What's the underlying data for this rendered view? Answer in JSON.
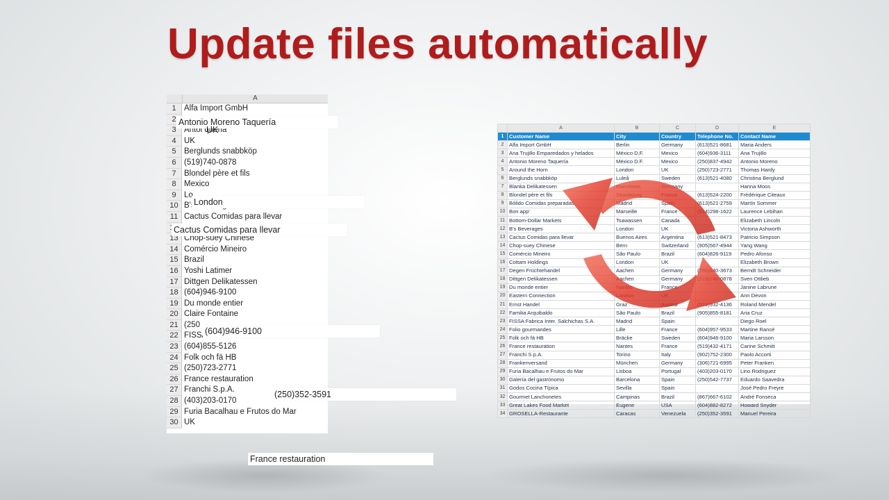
{
  "slide_title": "Update files automatically",
  "left_sheet": {
    "column_letter": "A",
    "rows": [
      {
        "n": "1",
        "v": "Alfa Import GmbH"
      },
      {
        "n": "2",
        "v": ""
      },
      {
        "n": "3",
        "v": "Antoi         queria"
      },
      {
        "n": "4",
        "v": "UK"
      },
      {
        "n": "5",
        "v": "Berglunds snabbköp"
      },
      {
        "n": "6",
        "v": "(519)740-0878"
      },
      {
        "n": "7",
        "v": "Blondel père et fils"
      },
      {
        "n": "8",
        "v": "Mexico"
      },
      {
        "n": "9",
        "v": "Lo"
      },
      {
        "n": "10",
        "v": "B's Beverages"
      },
      {
        "n": "11",
        "v": "Cactus Comidas para llevar"
      },
      {
        "n": "12",
        "v": ""
      },
      {
        "n": "13",
        "v": "Chop-suey Chinese"
      },
      {
        "n": "14",
        "v": "Comércio Mineiro"
      },
      {
        "n": "15",
        "v": "Brazil"
      },
      {
        "n": "16",
        "v": "Yoshi Latimer"
      },
      {
        "n": "17",
        "v": "Dittgen Delikatessen"
      },
      {
        "n": "18",
        "v": "(604)946-9100"
      },
      {
        "n": "19",
        "v": "Du monde entier"
      },
      {
        "n": "20",
        "v": "Claire Fontaine"
      },
      {
        "n": "21",
        "v": "(250"
      },
      {
        "n": "22",
        "v": "FISSA Fabrica Inter. Salchichas S.A."
      },
      {
        "n": "23",
        "v": "(604)855-5126"
      },
      {
        "n": "24",
        "v": "Folk och fä HB"
      },
      {
        "n": "25",
        "v": "(250)723-2771"
      },
      {
        "n": "26",
        "v": "France restauration"
      },
      {
        "n": "27",
        "v": "Franchi S.p.A."
      },
      {
        "n": "28",
        "v": "(403)203-0170"
      },
      {
        "n": "29",
        "v": "Furia Bacalhau e Frutos do Mar"
      },
      {
        "n": "30",
        "v": "UK"
      }
    ]
  },
  "floating_cells": {
    "antonio": "Antonio Moreno Taquería",
    "uk": "UK",
    "london": "London",
    "cactus": "Cactus Comidas para llevar",
    "phone1": "(604)946-9100",
    "phone2": "(250)352-3591",
    "france": "France restauration"
  },
  "right_sheet": {
    "column_letters": [
      "A",
      "B",
      "C",
      "D",
      "E"
    ],
    "headers": [
      "Customer Name",
      "City",
      "Country",
      "Telephone No.",
      "Contact Name"
    ],
    "rows": [
      [
        "Alfa Import GmbH",
        "Berlin",
        "Germany",
        "(613)521-8681",
        "Maria Anders"
      ],
      [
        "Ana Trujillo Emparedados y helados",
        "México D.F.",
        "Mexico",
        "(604)936-3111",
        "Ana Trujillo"
      ],
      [
        "Antonio Moreno Taquería",
        "México D.F.",
        "Mexico",
        "(250)837-4942",
        "Antonio Moreno"
      ],
      [
        "Around the Horn",
        "London",
        "UK",
        "(250)723-2771",
        "Thomas Hardy"
      ],
      [
        "Berglunds snabbköp",
        "Luleå",
        "Sweden",
        "(613)521-4080",
        "Christina Berglund"
      ],
      [
        "Blanka Delikatessen",
        "Mannheim",
        "Germany",
        "",
        "Hanna Moos"
      ],
      [
        "Blondel père et fils",
        "Strasbourg",
        "France",
        "(613)524-2200",
        "Frédérique Citeaux"
      ],
      [
        "Bólido Comidas preparadas",
        "Madrid",
        "Spain",
        "(613)521-2759",
        "Martín Sommer"
      ],
      [
        "Bon app'",
        "Marseille",
        "France",
        "(514)298-1622",
        "Laurence Lebihan"
      ],
      [
        "Bottom-Dollar Markets",
        "Tsawassen",
        "Canada",
        "",
        "Elizabeth Lincoln"
      ],
      [
        "B's Beverages",
        "London",
        "UK",
        "",
        "Victoria Ashworth"
      ],
      [
        "Cactus Comidas para llevar",
        "Buenos Aires",
        "Argentina",
        "(613)521-8473",
        "Patricio Simpson"
      ],
      [
        "Chop-suey Chinese",
        "Bern",
        "Switzerland",
        "(905)567-4944",
        "Yang Wang"
      ],
      [
        "Comércio Mineiro",
        "São Paulo",
        "Brazil",
        "(604)826-9119",
        "Pedro Afonso"
      ],
      [
        "Cottam Holdings",
        "London",
        "UK",
        "",
        "Elizabeth Brown"
      ],
      [
        "Degen Früchtehandel",
        "Aachen",
        "Germany",
        "(780)640-3673",
        "Berndt Schneider"
      ],
      [
        "Dittgen Delikatessen",
        "Aachen",
        "Germany",
        "(519)740-0878",
        "Sven Ottlieb"
      ],
      [
        "Du monde entier",
        "Nantes",
        "France",
        "",
        "Janine Labrune"
      ],
      [
        "Eastern Connection",
        "London",
        "UK",
        "",
        "Ann Devon"
      ],
      [
        "Ernst Handel",
        "Graz",
        "Austria",
        "(519)932-4136",
        "Roland Mendel"
      ],
      [
        "Familia Arquibaldo",
        "São Paulo",
        "Brazil",
        "(905)855-8181",
        "Aria Cruz"
      ],
      [
        "FISSA Fabrica Inter. Salchichas S.A.",
        "Madrid",
        "Spain",
        "",
        "Diego Roel"
      ],
      [
        "Folio gourmandes",
        "Lille",
        "France",
        "(604)957-9533",
        "Martine Rancé"
      ],
      [
        "Folk och fä HB",
        "Bräcke",
        "Sweden",
        "(604)946-9100",
        "Maria Larsson"
      ],
      [
        "France restauration",
        "Nantes",
        "France",
        "(519)432-4171",
        "Carine Schmitt"
      ],
      [
        "Franchi S.p.A.",
        "Torino",
        "Italy",
        "(902)752-2300",
        "Paolo Accorti"
      ],
      [
        "Frankenversand",
        "München",
        "Germany",
        "(306)721-6995",
        "Peter Franken"
      ],
      [
        "Furia Bacalhau e Frutos do Mar",
        "Lisboa",
        "Portugal",
        "(403)203-0170",
        "Lino Rodriguez"
      ],
      [
        "Galería del gastrónomo",
        "Barcelona",
        "Spain",
        "(250)542-7737",
        "Eduardo Saavedra"
      ],
      [
        "Godos Cocina Típica",
        "Sevilla",
        "Spain",
        "",
        "José Pedro Freyre"
      ],
      [
        "Gourmet Lanchonetes",
        "Campinas",
        "Brazil",
        "(867)667-6102",
        "André Fonseca"
      ],
      [
        "Great Lakes Food Market",
        "Eugene",
        "USA",
        "(604)882-8272",
        "Howard Snyder"
      ],
      [
        "GROSELLA-Restaurante",
        "Caracas",
        "Venezuela",
        "(250)352-3591",
        "Manuel Pereira"
      ]
    ]
  },
  "colors": {
    "title": "#b01c1c",
    "header_blue": "#1e8bd1",
    "arrow_red": "#e0392b"
  },
  "icons": [
    "refresh-cycle-icon"
  ]
}
